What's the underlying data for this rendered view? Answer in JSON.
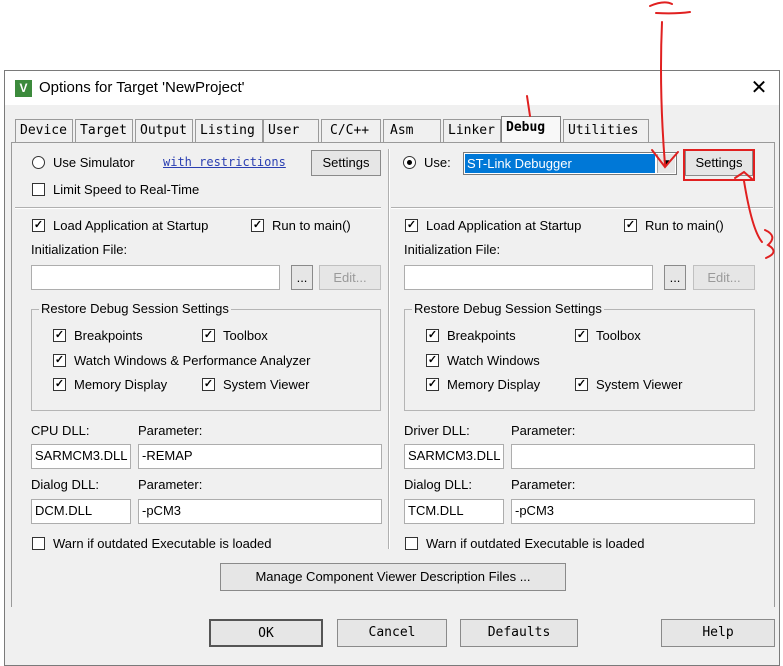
{
  "window": {
    "title": "Options for Target 'NewProject'"
  },
  "tabs": [
    "Device",
    "Target",
    "Output",
    "Listing",
    "User",
    "C/C++",
    "Asm",
    "Linker",
    "Debug",
    "Utilities"
  ],
  "left": {
    "use_simulator": "Use Simulator",
    "with_restrictions": "with restrictions",
    "settings": "Settings",
    "limit_speed": "Limit Speed to Real-Time",
    "load_app": "Load Application at Startup",
    "run_to_main": "Run to main()",
    "init_file_label": "Initialization File:",
    "init_file_value": "",
    "browse": "...",
    "edit": "Edit...",
    "restore_title": "Restore Debug Session Settings",
    "breakpoints": "Breakpoints",
    "toolbox": "Toolbox",
    "watch": "Watch Windows & Performance Analyzer",
    "memory": "Memory Display",
    "sysviewer": "System Viewer",
    "dll_label": "CPU DLL:",
    "dll_param_label": "Parameter:",
    "dll_value": "SARMCM3.DLL",
    "dll_param": "-REMAP",
    "dialog_label": "Dialog DLL:",
    "dialog_param_label": "Parameter:",
    "dialog_value": "DCM.DLL",
    "dialog_param": "-pCM3",
    "warn": "Warn if outdated Executable is loaded"
  },
  "right": {
    "use": "Use:",
    "debugger": "ST-Link Debugger",
    "settings": "Settings",
    "load_app": "Load Application at Startup",
    "run_to_main": "Run to main()",
    "init_file_label": "Initialization File:",
    "init_file_value": "",
    "browse": "...",
    "edit": "Edit...",
    "restore_title": "Restore Debug Session Settings",
    "breakpoints": "Breakpoints",
    "toolbox": "Toolbox",
    "watch": "Watch Windows",
    "memory": "Memory Display",
    "sysviewer": "System Viewer",
    "dll_label": "Driver DLL:",
    "dll_param_label": "Parameter:",
    "dll_value": "SARMCM3.DLL",
    "dll_param": "",
    "dialog_label": "Dialog DLL:",
    "dialog_param_label": "Parameter:",
    "dialog_value": "TCM.DLL",
    "dialog_param": "-pCM3",
    "warn": "Warn if outdated Executable is loaded"
  },
  "manage_button": "Manage Component Viewer Description Files ...",
  "footer": {
    "ok": "OK",
    "cancel": "Cancel",
    "defaults": "Defaults",
    "help": "Help"
  },
  "checks": {
    "left": {
      "limit_speed": false,
      "load_app": true,
      "run_to_main": true,
      "breakpoints": true,
      "toolbox": true,
      "watch": true,
      "memory": true,
      "sysviewer": true,
      "warn": false
    },
    "right": {
      "load_app": true,
      "run_to_main": true,
      "breakpoints": true,
      "toolbox": true,
      "watch": true,
      "memory": true,
      "sysviewer": true,
      "warn": false
    }
  },
  "annotation_color": "#e02020",
  "icons": {
    "close": "close-icon",
    "app": "keil-app-icon",
    "dropdown": "chevron-down-icon",
    "check": "check-icon"
  }
}
